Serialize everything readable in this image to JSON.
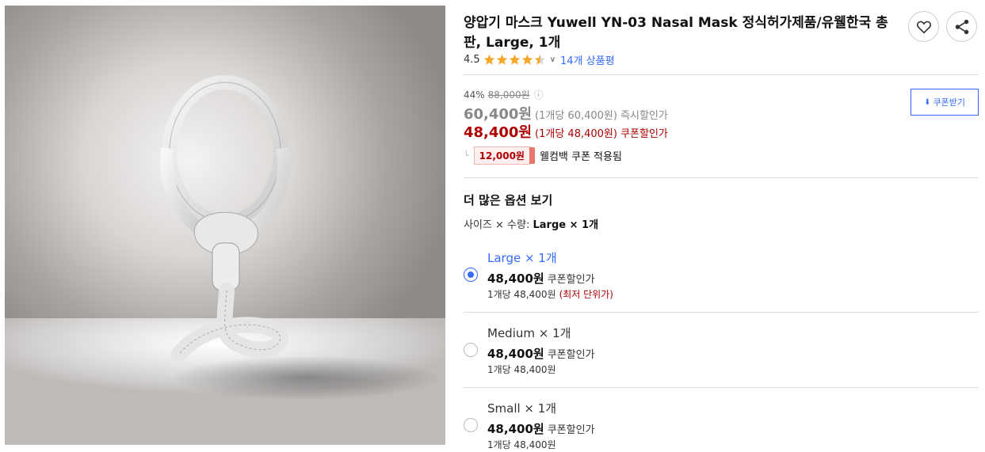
{
  "product": {
    "title": "양압기 마스크 Yuwell YN-03 Nasal Mask 정식허가제품/유웰한국 총판, Large, 1개",
    "rating": "4.5",
    "review_link": "14개 상품평"
  },
  "pricing": {
    "discount_pct": "44%",
    "original_price": "88,000원",
    "instant_price": "60,400원",
    "instant_unit": "(1개당 60,400원) 즉시할인가",
    "coupon_price": "48,400원",
    "coupon_unit": "(1개당 48,400원) 쿠폰할인가",
    "welcome_amount": "12,000원",
    "welcome_text": "웰컴백 쿠폰 적용됨",
    "coupon_button": "쿠폰받기"
  },
  "options": {
    "section_title": "더 많은 옵션 보기",
    "summary_label": "사이즈 × 수량:",
    "summary_value": "Large × 1개",
    "items": [
      {
        "name": "Large × 1개",
        "price": "48,400원",
        "price_label": "쿠폰할인가",
        "per": "1개당 48,400원",
        "tag": "(최저 단위가)",
        "selected": true
      },
      {
        "name": "Medium × 1개",
        "price": "48,400원",
        "price_label": "쿠폰할인가",
        "per": "1개당 48,400원",
        "tag": "",
        "selected": false
      },
      {
        "name": "Small × 1개",
        "price": "48,400원",
        "price_label": "쿠폰할인가",
        "per": "1개당 48,400원",
        "tag": "",
        "selected": false
      }
    ]
  },
  "icons": {
    "heart": "heart-icon",
    "share": "share-icon",
    "star": "star-icon",
    "info": "info-icon",
    "download": "download-icon"
  },
  "colors": {
    "accent": "#346aff",
    "sale_red": "#ae0000",
    "star": "#f5a623"
  }
}
